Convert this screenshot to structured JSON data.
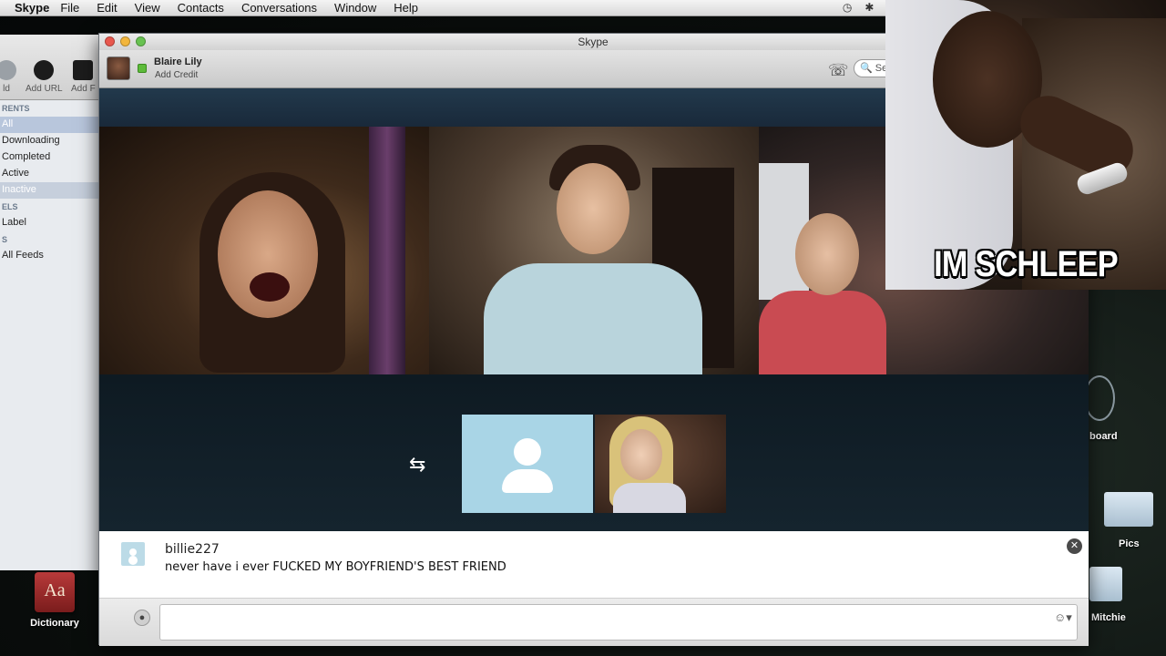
{
  "menubar": {
    "app_name": "Skype",
    "items": [
      "File",
      "Edit",
      "View",
      "Contacts",
      "Conversations",
      "Window",
      "Help"
    ]
  },
  "background_window": {
    "toolbar": [
      "ld",
      "Add URL",
      "Add F"
    ],
    "sections": [
      {
        "header": "RENTS",
        "items": [
          "All",
          "Downloading",
          "Completed",
          "Active",
          "Inactive"
        ]
      },
      {
        "header": "ELS",
        "items": [
          "Label"
        ]
      },
      {
        "header": "S",
        "items": [
          "All Feeds"
        ]
      }
    ]
  },
  "desktop": {
    "dictionary_label": "Dictionary",
    "dictionary_icon_text": "Aa",
    "right_labels": [
      "board",
      "Pics",
      "Mitchie"
    ]
  },
  "skype": {
    "window_title": "Skype",
    "user_name": "Blaire Lily",
    "add_credit": "Add Credit",
    "search_placeholder": "Sea",
    "swap_icon": "swap-icon",
    "chat": {
      "sender": "billie227",
      "message": "never have i ever FUCKED MY BOYFRIEND'S BEST FRIEND",
      "input_value": ""
    }
  },
  "meme": {
    "caption": "IM SCHLEEP"
  }
}
